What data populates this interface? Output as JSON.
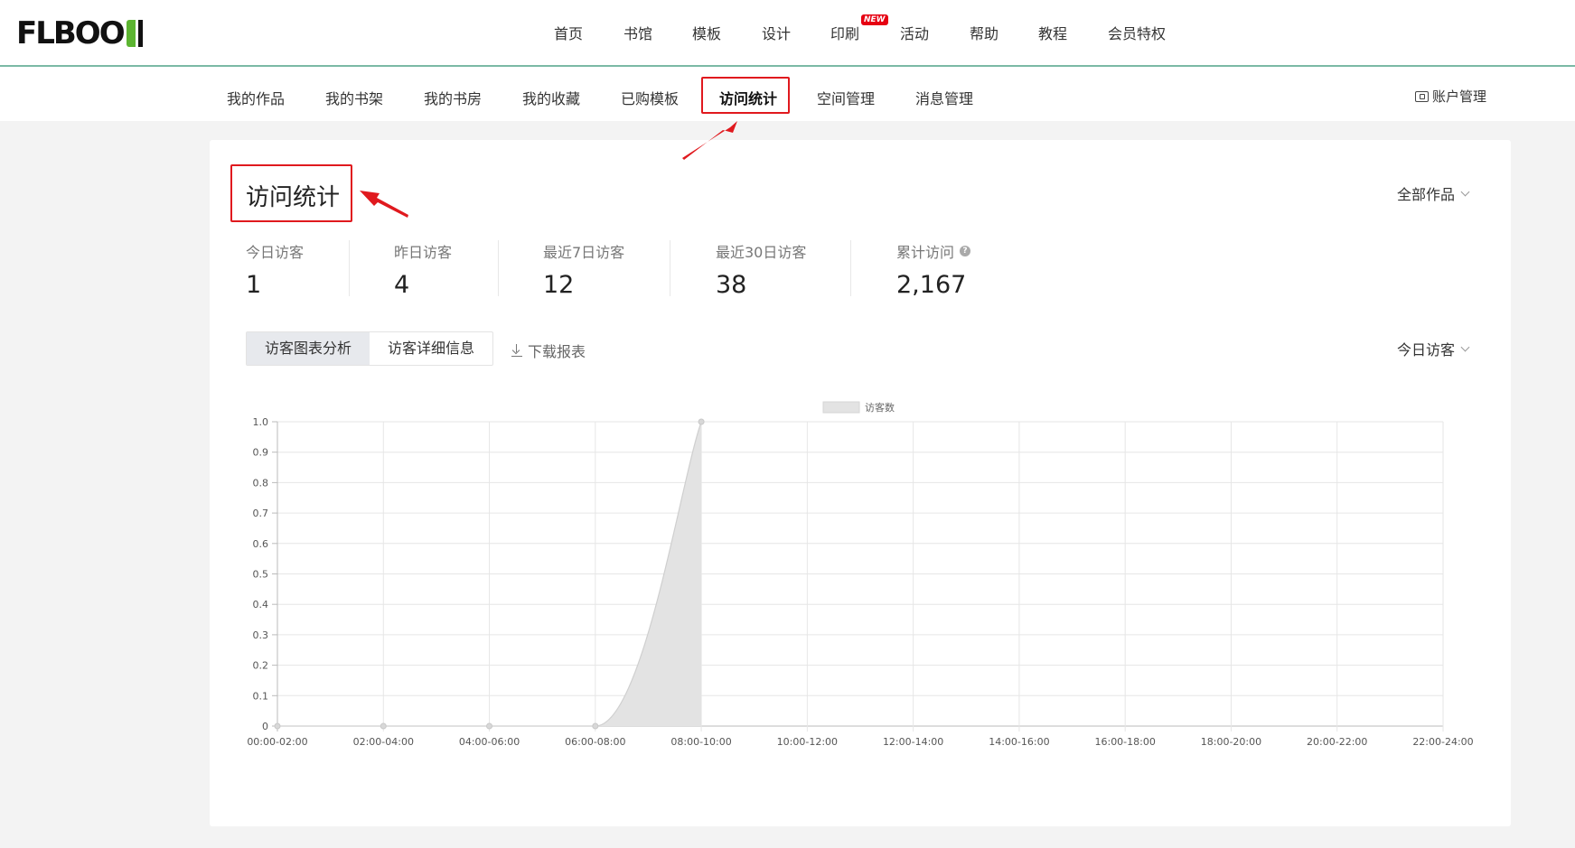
{
  "header": {
    "logo_text": "FLBOO",
    "nav": [
      {
        "label": "首页"
      },
      {
        "label": "书馆"
      },
      {
        "label": "模板"
      },
      {
        "label": "设计"
      },
      {
        "label": "印刷",
        "badge": "NEW"
      },
      {
        "label": "活动"
      },
      {
        "label": "帮助"
      },
      {
        "label": "教程"
      },
      {
        "label": "会员特权"
      }
    ]
  },
  "subnav": {
    "items": [
      {
        "label": "我的作品"
      },
      {
        "label": "我的书架"
      },
      {
        "label": "我的书房"
      },
      {
        "label": "我的收藏"
      },
      {
        "label": "已购模板"
      },
      {
        "label": "访问统计",
        "active": true
      },
      {
        "label": "空间管理"
      },
      {
        "label": "消息管理"
      }
    ],
    "account_label": "账户管理"
  },
  "page": {
    "title": "访问统计",
    "works_filter": "全部作品",
    "stats": [
      {
        "label": "今日访客",
        "value": "1"
      },
      {
        "label": "昨日访客",
        "value": "4"
      },
      {
        "label": "最近7日访客",
        "value": "12"
      },
      {
        "label": "最近30日访客",
        "value": "38"
      },
      {
        "label": "累计访问",
        "value": "2,167",
        "help_icon": "question-icon"
      }
    ],
    "tabs": [
      {
        "label": "访客图表分析",
        "active": true
      },
      {
        "label": "访客详细信息"
      }
    ],
    "download_label": "下载报表",
    "range_filter": "今日访客"
  },
  "colors": {
    "highlight": "#e0191e",
    "header_border": "#7bb9a5",
    "logo_green": "#5cb531",
    "area_fill": "#e3e3e3",
    "area_stroke": "#cfcfcf"
  },
  "chart_data": {
    "type": "area",
    "categories": [
      "00:00-02:00",
      "02:00-04:00",
      "04:00-06:00",
      "06:00-08:00",
      "08:00-10:00",
      "10:00-12:00",
      "12:00-14:00",
      "14:00-16:00",
      "16:00-18:00",
      "18:00-20:00",
      "20:00-22:00",
      "22:00-24:00"
    ],
    "series": [
      {
        "name": "访客数",
        "values": [
          0,
          0,
          0,
          0,
          1,
          null,
          null,
          null,
          null,
          null,
          null,
          null
        ]
      }
    ],
    "yticks": [
      "0",
      "0.1",
      "0.2",
      "0.3",
      "0.4",
      "0.5",
      "0.6",
      "0.7",
      "0.8",
      "0.9",
      "1.0"
    ],
    "ylim": [
      0,
      1.0
    ],
    "grid": true,
    "legend": "top-center"
  }
}
